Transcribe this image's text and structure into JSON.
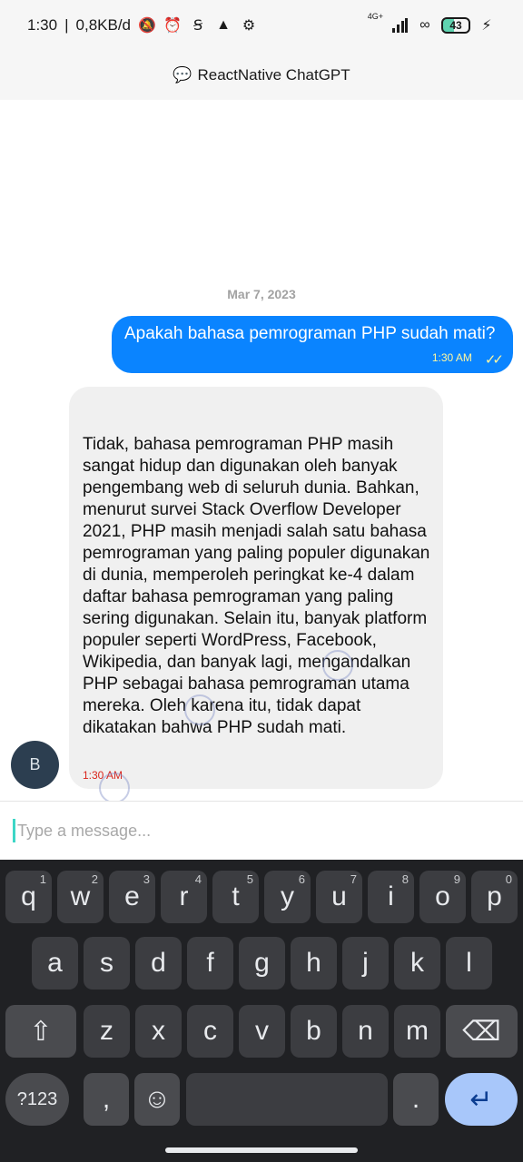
{
  "status_bar": {
    "time": "1:30",
    "separator": "|",
    "speed": "0,8KB/d",
    "network_label": "4G+",
    "battery": "43",
    "icons": [
      "mute-icon",
      "alarm-icon",
      "app-icon",
      "vpn-icon",
      "settings-icon",
      "signal-icon",
      "link-icon",
      "battery-icon",
      "charging-icon"
    ]
  },
  "header": {
    "icon": "speech-bubble-icon",
    "title": "ReactNative ChatGPT"
  },
  "chat": {
    "date": "Mar 7, 2023",
    "outgoing": {
      "text": "Apakah bahasa pemrograman PHP sudah mati?",
      "time": "1:30 AM",
      "status": "✓✓"
    },
    "incoming": {
      "text": "Tidak, bahasa pemrograman PHP masih sangat hidup dan digunakan oleh banyak pengembang web di seluruh dunia. Bahkan, menurut survei Stack Overflow Developer 2021, PHP masih menjadi salah satu bahasa pemrograman yang paling populer digunakan di dunia, memperoleh peringkat ke-4 dalam daftar bahasa pemrograman yang paling sering digunakan. Selain itu, banyak platform populer seperti WordPress, Facebook, Wikipedia, dan banyak lagi, mengandalkan PHP sebagai bahasa pemrograman utama mereka. Oleh karena itu, tidak dapat dikatakan bahwa PHP sudah mati.",
      "time": "1:30 AM",
      "avatar_letter": "B"
    }
  },
  "composer": {
    "placeholder": "Type a message..."
  },
  "keyboard": {
    "row1": [
      {
        "k": "q",
        "h": "1"
      },
      {
        "k": "w",
        "h": "2"
      },
      {
        "k": "e",
        "h": "3"
      },
      {
        "k": "r",
        "h": "4"
      },
      {
        "k": "t",
        "h": "5"
      },
      {
        "k": "y",
        "h": "6"
      },
      {
        "k": "u",
        "h": "7"
      },
      {
        "k": "i",
        "h": "8"
      },
      {
        "k": "o",
        "h": "9"
      },
      {
        "k": "p",
        "h": "0"
      }
    ],
    "row2": [
      "a",
      "s",
      "d",
      "f",
      "g",
      "h",
      "j",
      "k",
      "l"
    ],
    "row3": [
      "z",
      "x",
      "c",
      "v",
      "b",
      "n",
      "m"
    ],
    "symbols_label": "?123",
    "comma": ",",
    "period": ".",
    "icons": {
      "shift": "⇧",
      "backspace": "⌫",
      "emoji": "☺",
      "enter": "↵"
    }
  }
}
